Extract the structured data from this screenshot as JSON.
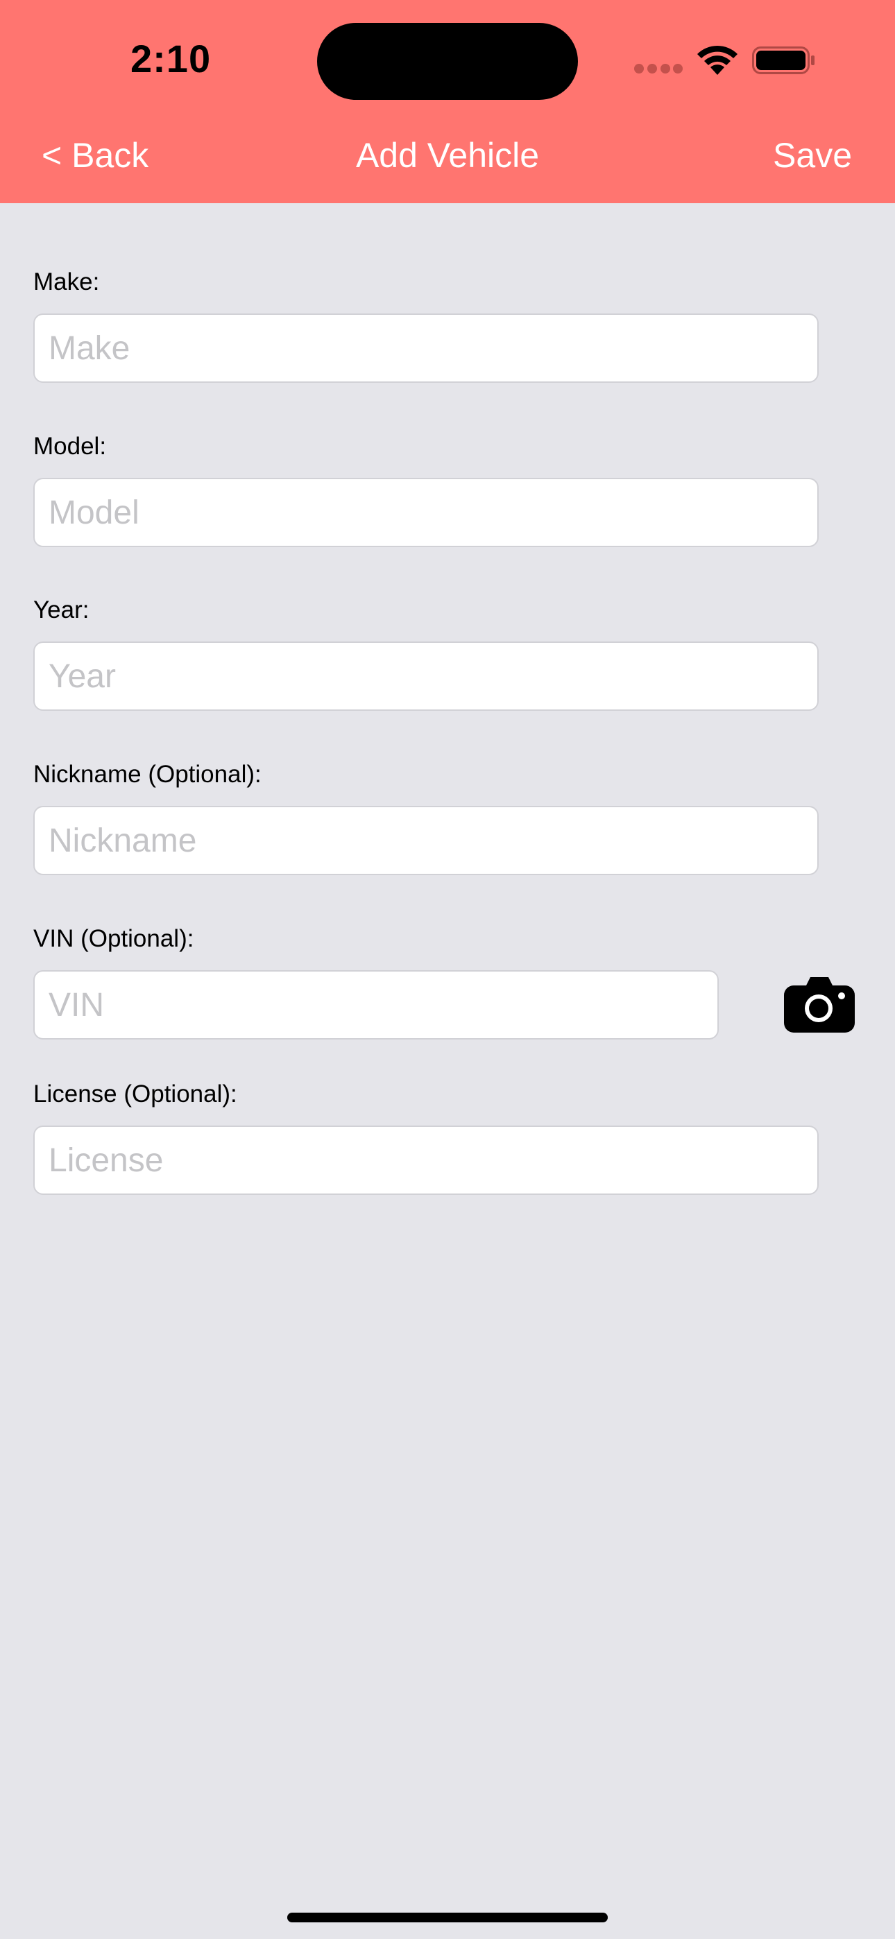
{
  "status_bar": {
    "time": "2:10",
    "wifi_icon": "wifi-icon",
    "battery_icon": "battery-icon"
  },
  "nav": {
    "back_label": "< Back",
    "title": "Add Vehicle",
    "save_label": "Save"
  },
  "form": {
    "make": {
      "label": "Make:",
      "placeholder": "Make",
      "value": ""
    },
    "model": {
      "label": "Model:",
      "placeholder": "Model",
      "value": ""
    },
    "year": {
      "label": "Year:",
      "placeholder": "Year",
      "value": ""
    },
    "nickname": {
      "label": "Nickname (Optional):",
      "placeholder": "Nickname",
      "value": ""
    },
    "vin": {
      "label": "VIN (Optional):",
      "placeholder": "VIN",
      "value": "",
      "scan_icon": "camera-icon"
    },
    "license": {
      "label": "License (Optional):",
      "placeholder": "License",
      "value": ""
    }
  },
  "colors": {
    "header_background": "#ff7570",
    "page_background": "#e5e5ea",
    "nav_text": "#ffffff",
    "placeholder_text": "#c4c4c7"
  }
}
